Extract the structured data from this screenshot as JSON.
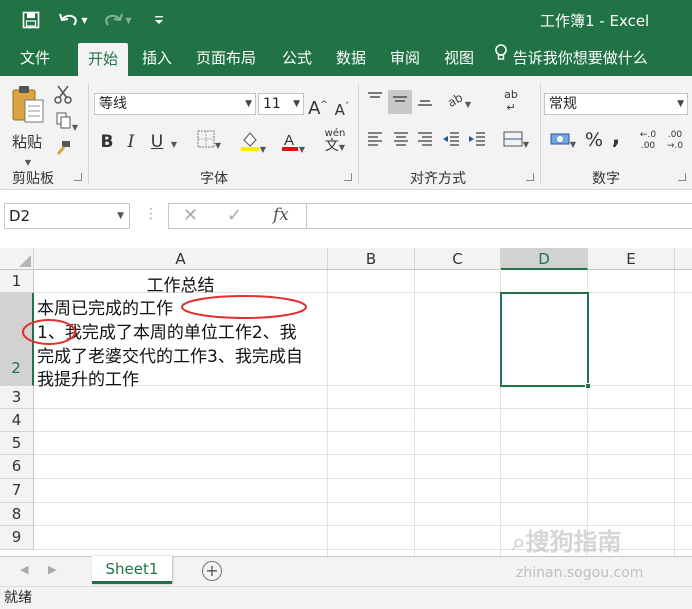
{
  "app": {
    "title": "工作簿1  -  Excel",
    "accent_color": "#217346",
    "quick_access": [
      "save-icon",
      "undo-icon",
      "redo-icon",
      "customize-icon"
    ]
  },
  "menu": {
    "tabs": [
      {
        "label": "文件"
      },
      {
        "label": "开始"
      },
      {
        "label": "插入"
      },
      {
        "label": "页面布局"
      },
      {
        "label": "公式"
      },
      {
        "label": "数据"
      },
      {
        "label": "审阅"
      },
      {
        "label": "视图"
      }
    ],
    "active": "开始",
    "tell_me": "告诉我你想要做什么"
  },
  "ribbon": {
    "clipboard": {
      "label": "剪贴板",
      "paste_label": "粘贴"
    },
    "font": {
      "label": "字体",
      "name": "等线",
      "size": "11",
      "grow": "A",
      "shrink": "A",
      "bold": "B",
      "italic": "I",
      "underline": "U",
      "phonetic": "wén"
    },
    "alignment": {
      "label": "对齐方式",
      "wrap_icon": "ab"
    },
    "number": {
      "label": "数字",
      "format": "常规",
      "percent": "%",
      "comma": ",",
      "inc_decimal": "←.0\n.00",
      "dec_decimal": ".00\n→.0"
    }
  },
  "formula_bar": {
    "name_box": "D2",
    "fx": "fx",
    "value": ""
  },
  "sheet": {
    "columns": [
      "A",
      "B",
      "C",
      "D",
      "E"
    ],
    "selected_column": "D",
    "rows": [
      "1",
      "2",
      "3",
      "4",
      "5",
      "6",
      "7",
      "8",
      "9"
    ],
    "active_cell": "D2",
    "cells": {
      "A1": "工作总结",
      "A2_lines": [
        "本周已完成的工作",
        "1、我完成了本周的单位工作2、我",
        "完成了老婆交代的工作3、我完成自",
        "我提升的工作"
      ]
    }
  },
  "sheet_tabs": {
    "tabs": [
      "Sheet1"
    ],
    "active": "Sheet1"
  },
  "status": {
    "text": "就绪"
  },
  "watermark": {
    "brand": "搜狗指南",
    "url": "zhinan.sogou.com"
  }
}
